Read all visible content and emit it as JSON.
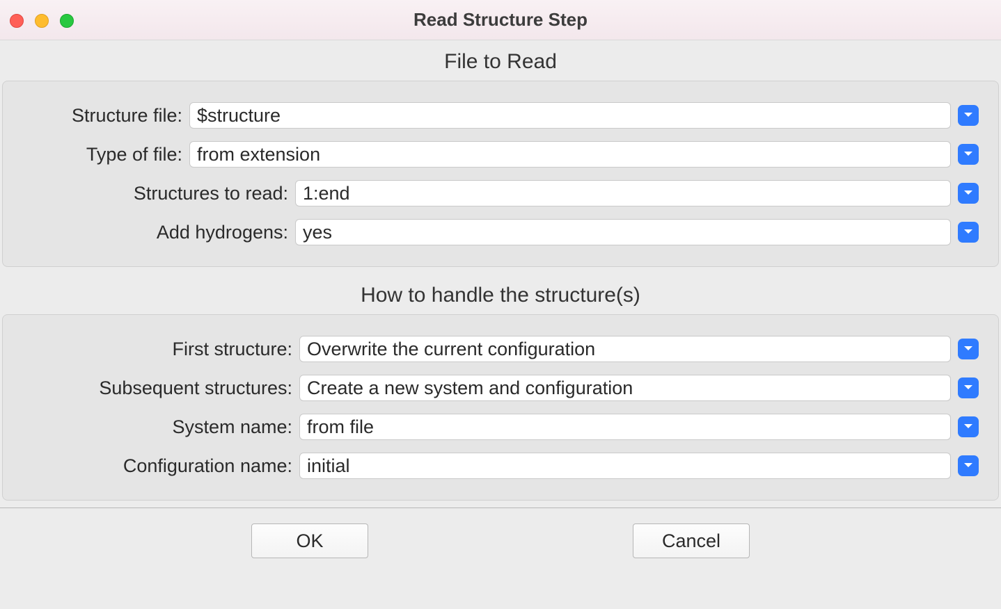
{
  "window": {
    "title": "Read Structure Step"
  },
  "section1": {
    "title": "File to Read",
    "structure_file": {
      "label": "Structure file:",
      "value": "$structure"
    },
    "type_of_file": {
      "label": "Type of file:",
      "value": "from extension"
    },
    "structures_to_read": {
      "label": "Structures to read:",
      "value": "1:end"
    },
    "add_hydrogens": {
      "label": "Add hydrogens:",
      "value": "yes"
    }
  },
  "section2": {
    "title": "How to handle the structure(s)",
    "first_structure": {
      "label": "First structure:",
      "value": "Overwrite the current configuration"
    },
    "subsequent_structures": {
      "label": "Subsequent structures:",
      "value": "Create a new system and configuration"
    },
    "system_name": {
      "label": "System name:",
      "value": "from file"
    },
    "configuration_name": {
      "label": "Configuration name:",
      "value": "initial"
    }
  },
  "buttons": {
    "ok": "OK",
    "cancel": "Cancel"
  }
}
